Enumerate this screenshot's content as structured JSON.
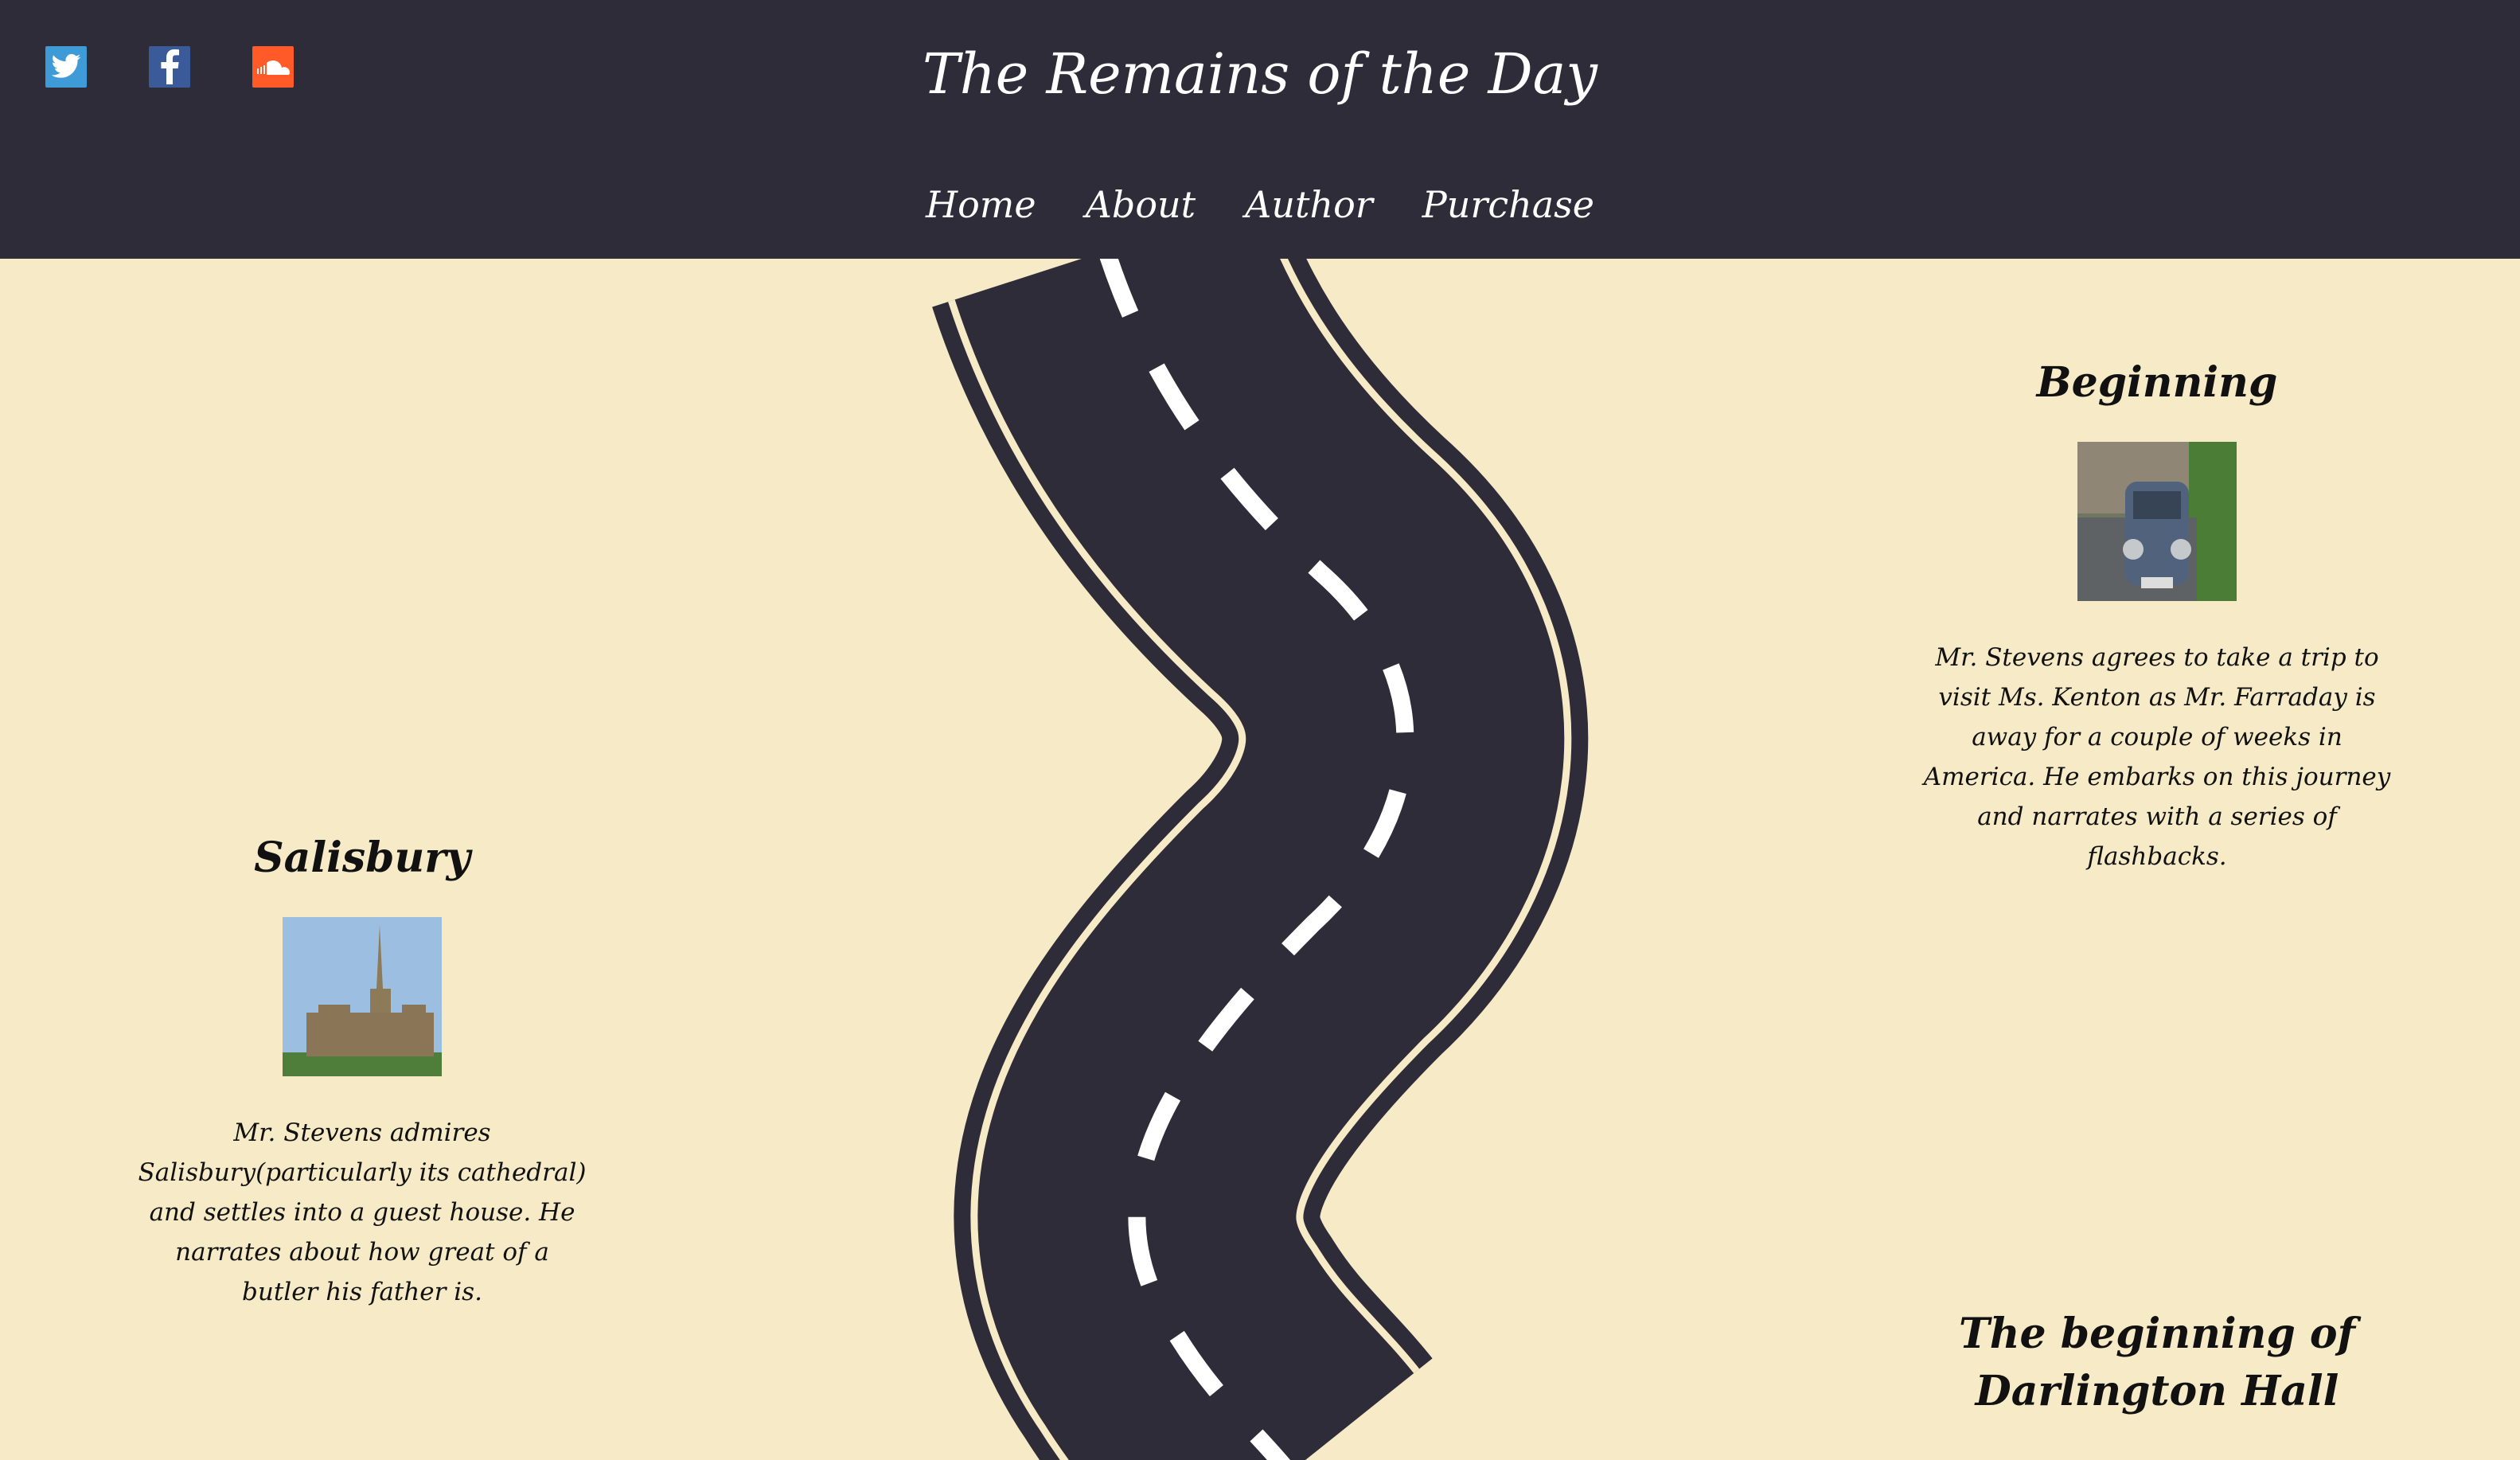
{
  "site": {
    "title": "The Remains of the Day"
  },
  "social": [
    {
      "name": "twitter-icon",
      "color": "#3f9bd8"
    },
    {
      "name": "facebook-icon",
      "color": "#3a5a9a"
    },
    {
      "name": "soundcloud-icon",
      "color": "#ff5a28"
    }
  ],
  "nav": {
    "items": [
      "Home",
      "About",
      "Author",
      "Purchase"
    ]
  },
  "events": {
    "beginning": {
      "title": "Beginning",
      "image": "vintage-car-photo",
      "text": "Mr. Stevens agrees to take a trip to visit Ms. Kenton as Mr. Farraday is away for a couple of weeks in America. He embarks on this journey and narrates with a series of flashbacks."
    },
    "salisbury": {
      "title": "Salisbury",
      "image": "salisbury-cathedral-photo",
      "text": "Mr. Stevens admires Salisbury(particularly its cathedral) and settles into a guest house. He narrates about how great of a butler his father is."
    },
    "darlington": {
      "title": "The beginning of Darlington Hall"
    }
  },
  "colors": {
    "header": "#2e2c38",
    "background": "#f6ebc6",
    "road": "#2e2c38",
    "road_lines": "#ffffff"
  }
}
